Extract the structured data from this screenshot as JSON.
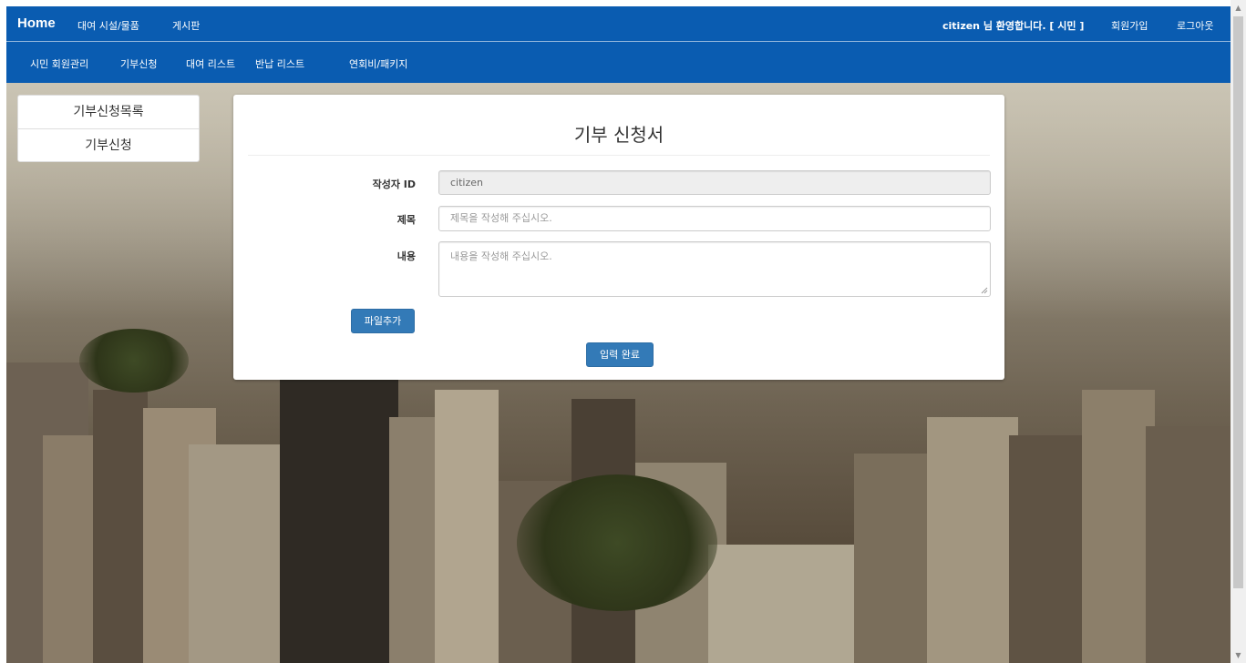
{
  "nav": {
    "brand": "Home",
    "menu": [
      "대여 시설/물품",
      "게시판"
    ],
    "welcome": "citizen 님 환영합니다. [ 시민 ]",
    "signup": "회원가입",
    "logout": "로그아웃",
    "submenu": [
      "시민 회원관리",
      "기부신청",
      "대여 리스트",
      "반납 리스트",
      "연회비/패키지"
    ]
  },
  "sidebar": {
    "items": [
      "기부신청목록",
      "기부신청"
    ]
  },
  "form": {
    "title": "기부 신청서",
    "author_label": "작성자 ID",
    "author_value": "citizen",
    "subject_label": "제목",
    "subject_placeholder": "제목을 작성해 주십시오.",
    "content_label": "내용",
    "content_placeholder": "내용을 작성해 주십시오.",
    "add_file_label": "파일추가",
    "submit_label": "입력 완료"
  },
  "colors": {
    "navbar": "#0a5cb1",
    "button": "#337ab7"
  }
}
